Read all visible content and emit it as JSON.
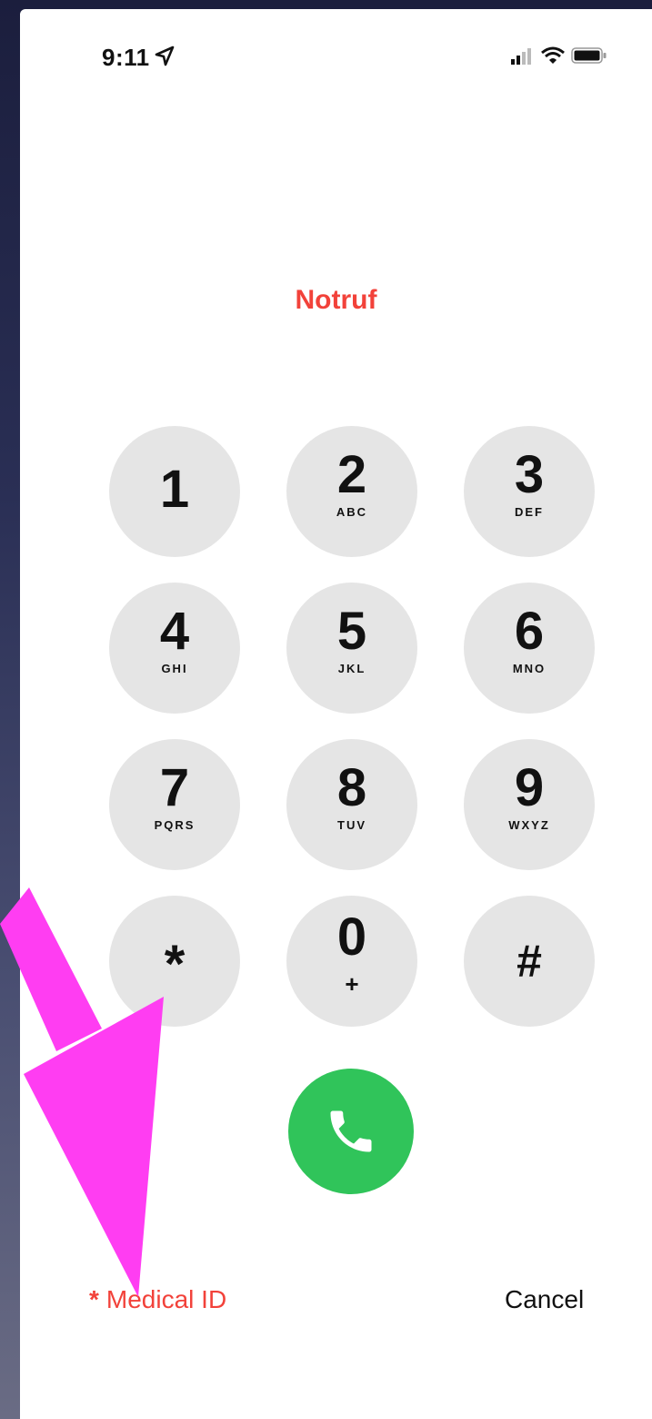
{
  "status_bar": {
    "time": "9:11",
    "icons": [
      "location-arrow-icon",
      "cellular-signal-icon",
      "wifi-icon",
      "battery-icon"
    ]
  },
  "emergency_label": "Notruf",
  "keypad": {
    "keys": [
      {
        "digit": "1",
        "letters": ""
      },
      {
        "digit": "2",
        "letters": "ABC"
      },
      {
        "digit": "3",
        "letters": "DEF"
      },
      {
        "digit": "4",
        "letters": "GHI"
      },
      {
        "digit": "5",
        "letters": "JKL"
      },
      {
        "digit": "6",
        "letters": "MNO"
      },
      {
        "digit": "7",
        "letters": "PQRS"
      },
      {
        "digit": "8",
        "letters": "TUV"
      },
      {
        "digit": "9",
        "letters": "WXYZ"
      },
      {
        "digit": "*",
        "letters": ""
      },
      {
        "digit": "0",
        "letters": "+"
      },
      {
        "digit": "#",
        "letters": ""
      }
    ]
  },
  "call_button": {
    "icon": "phone-icon"
  },
  "footer": {
    "medical_id_icon": "*",
    "medical_id_label": "Medical ID",
    "cancel_label": "Cancel"
  },
  "colors": {
    "accent_red": "#f2423a",
    "call_green": "#30c45a",
    "key_gray": "#e5e5e5",
    "annotation_arrow": "#ff3df2"
  }
}
